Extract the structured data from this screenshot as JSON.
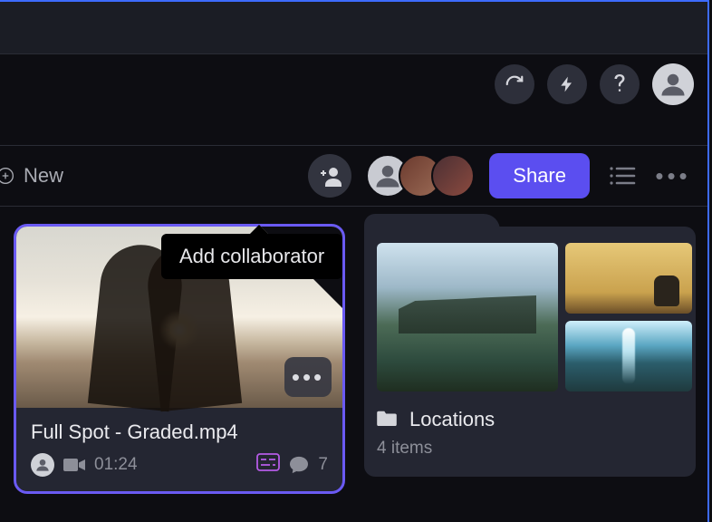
{
  "toolbar": {
    "new_label": "New",
    "share_label": "Share"
  },
  "tooltip": {
    "add_collaborator": "Add collaborator"
  },
  "cards": {
    "video": {
      "title": "Full Spot - Graded.mp4",
      "duration": "01:24",
      "comment_count": "7"
    },
    "folder": {
      "title": "Locations",
      "subtitle": "4 items"
    }
  }
}
